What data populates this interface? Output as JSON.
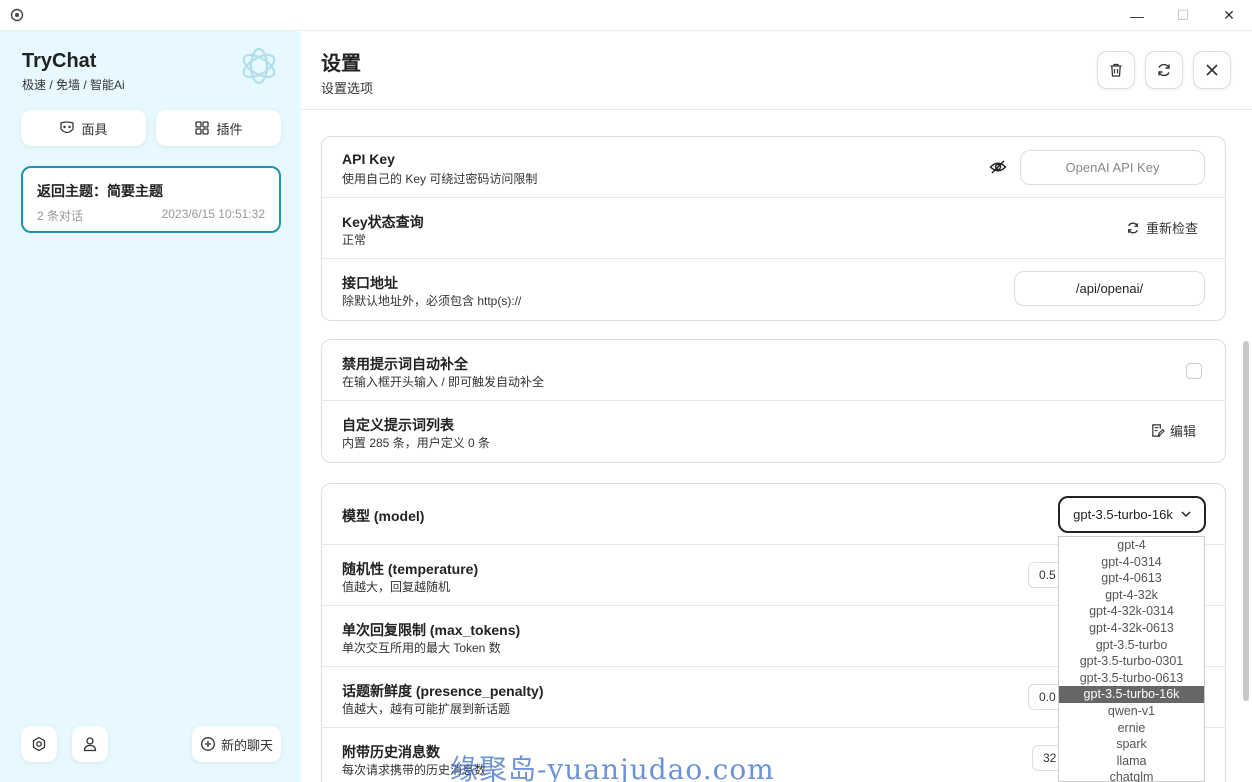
{
  "window": {
    "minimize": "—",
    "maximize": "☐",
    "close": "✕"
  },
  "sidebar": {
    "title": "TryChat",
    "subtitle": "极速 / 免墙 / 智能Ai",
    "mask_label": "面具",
    "plugin_label": "插件",
    "chat_item": {
      "title": "返回主题：简要主题",
      "count": "2 条对话",
      "time": "2023/6/15 10:51:32"
    },
    "new_chat_label": "新的聊天"
  },
  "header": {
    "title": "设置",
    "subtitle": "设置选项"
  },
  "settings": {
    "api_key": {
      "title": "API Key",
      "desc": "使用自己的 Key 可绕过密码访问限制",
      "placeholder": "OpenAI API Key"
    },
    "key_status": {
      "title": "Key状态查询",
      "desc": "正常",
      "action": "重新检查"
    },
    "endpoint": {
      "title": "接口地址",
      "desc": "除默认地址外，必须包含 http(s)://",
      "value": "/api/openai/"
    },
    "disable_prompt": {
      "title": "禁用提示词自动补全",
      "desc": "在输入框开头输入 / 即可触发自动补全"
    },
    "prompt_list": {
      "title": "自定义提示词列表",
      "desc": "内置 285 条，用户定义 0 条",
      "action": "编辑"
    },
    "model": {
      "title": "模型 (model)",
      "selected": "gpt-3.5-turbo-16k",
      "options": [
        "gpt-4",
        "gpt-4-0314",
        "gpt-4-0613",
        "gpt-4-32k",
        "gpt-4-32k-0314",
        "gpt-4-32k-0613",
        "gpt-3.5-turbo",
        "gpt-3.5-turbo-0301",
        "gpt-3.5-turbo-0613",
        "gpt-3.5-turbo-16k",
        "qwen-v1",
        "ernie",
        "spark",
        "llama",
        "chatglm"
      ]
    },
    "temperature": {
      "title": "随机性 (temperature)",
      "desc": "值越大，回复越随机",
      "value": "0.5"
    },
    "max_tokens": {
      "title": "单次回复限制 (max_tokens)",
      "desc": "单次交互所用的最大 Token 数"
    },
    "presence_penalty": {
      "title": "话题新鲜度 (presence_penalty)",
      "desc": "值越大，越有可能扩展到新话题",
      "value": "0.0"
    },
    "history_count": {
      "title": "附带历史消息数",
      "desc": "每次请求携带的历史消息数",
      "value": "32"
    }
  },
  "watermark": "缘聚岛-yuanjudao.com",
  "colors": {
    "sidebar_bg": "#e7f8ff",
    "accent": "#1d93ab",
    "selected_option": "#666666"
  }
}
